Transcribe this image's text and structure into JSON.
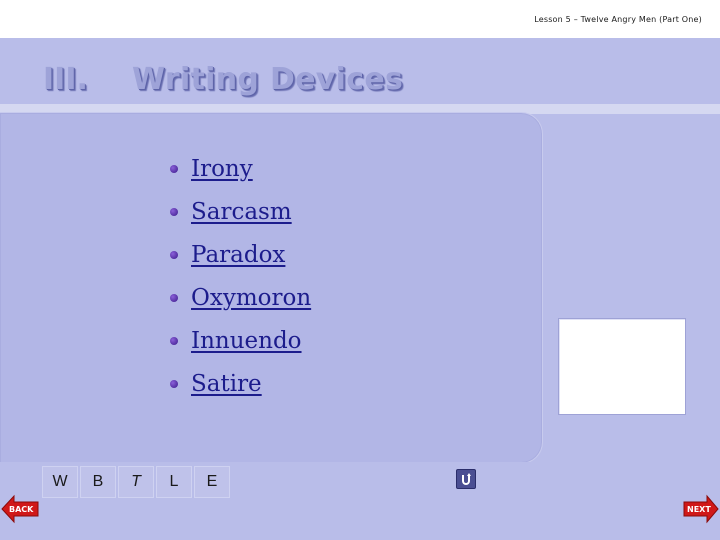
{
  "header": {
    "lesson_title": "Lesson 5 – Twelve Angry Men (Part One)"
  },
  "section": {
    "number": "III.",
    "title": "Writing Devices"
  },
  "bullets": [
    {
      "label": "Irony"
    },
    {
      "label": "Sarcasm"
    },
    {
      "label": "Paradox"
    },
    {
      "label": "Oxymoron"
    },
    {
      "label": "Innuendo"
    },
    {
      "label": "Satire"
    }
  ],
  "format_bar": {
    "buttons": [
      "W",
      "B",
      "T",
      "L",
      "E"
    ]
  },
  "nav": {
    "back_label": "BACK",
    "next_label": "NEXT"
  },
  "colors": {
    "background": "#b9bde9",
    "panel": "#b2b6e6",
    "link": "#1c1c8c",
    "nav_red": "#d01818"
  },
  "icons": {
    "return": "return-arrow-icon",
    "back": "back-arrow-icon",
    "next": "next-arrow-icon",
    "bullet": "bullet-dot-icon"
  }
}
